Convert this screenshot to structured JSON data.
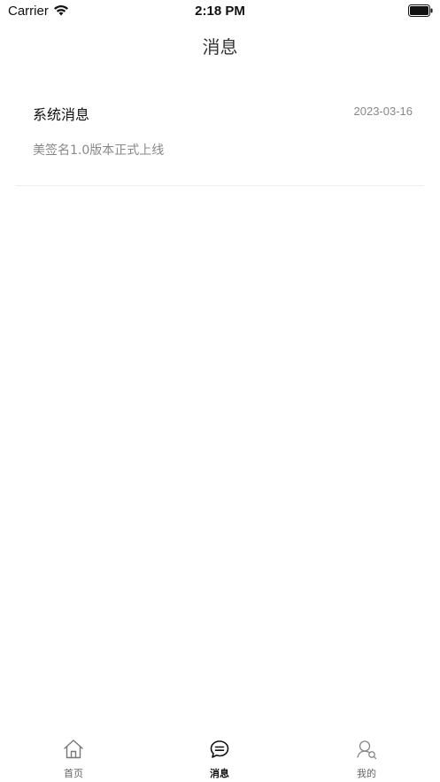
{
  "status_bar": {
    "carrier": "Carrier",
    "time": "2:18 PM"
  },
  "nav": {
    "title": "消息"
  },
  "messages": [
    {
      "title": "系统消息",
      "date": "2023-03-16",
      "preview": "美签名1.0版本正式上线"
    }
  ],
  "tab_bar": {
    "tabs": [
      {
        "label": "首页",
        "icon": "home-icon",
        "active": false
      },
      {
        "label": "消息",
        "icon": "message-icon",
        "active": true
      },
      {
        "label": "我的",
        "icon": "profile-icon",
        "active": false
      }
    ]
  },
  "colors": {
    "active_tab": "#111111",
    "inactive_tab": "#666666",
    "secondary_text": "#888888",
    "divider": "#eeeeee"
  }
}
